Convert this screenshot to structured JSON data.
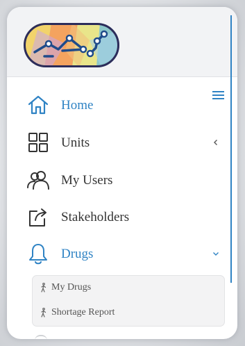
{
  "brand": {
    "logo_icon": "network-graph-logo"
  },
  "colors": {
    "accent": "#2f83c4",
    "text": "#333333",
    "submenu_bg": "#f3f3f4"
  },
  "menu": [
    {
      "label": "Home",
      "icon": "home-icon",
      "active": true
    },
    {
      "label": "Units",
      "icon": "grid-icon",
      "chevron": "chevron-left-icon"
    },
    {
      "label": "My Users",
      "icon": "users-icon"
    },
    {
      "label": "Stakeholders",
      "icon": "share-icon"
    },
    {
      "label": "Drugs",
      "icon": "bell-icon",
      "active": true,
      "expanded": true,
      "chevron": "chevron-down-icon"
    }
  ],
  "submenu": [
    {
      "label": "My Drugs",
      "icon": "person-walking-icon"
    },
    {
      "label": "Shortage Report",
      "icon": "person-walking-icon"
    }
  ]
}
